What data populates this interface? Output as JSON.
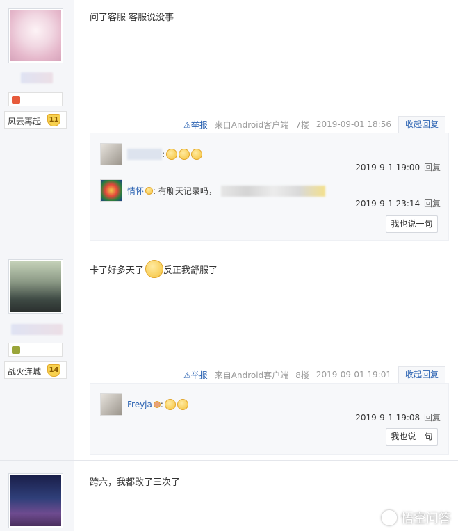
{
  "watermark": "悟空问答",
  "posts": [
    {
      "user": {
        "level_title": "风云再起",
        "level": "11"
      },
      "content": "问了客服 客服说没事",
      "meta": {
        "report": "举报",
        "source": "来自Android客户端",
        "floor": "7楼",
        "time": "2019-09-01 18:56",
        "toggle": "收起回复"
      },
      "replies": [
        {
          "name": "",
          "text": ":",
          "time": "2019-9-1 19:00",
          "reply": "回复"
        },
        {
          "name": "情怀",
          "text": ": 有聊天记录吗，",
          "time": "2019-9-1 23:14",
          "reply": "回复"
        }
      ],
      "say_button": "我也说一句"
    },
    {
      "user": {
        "level_title": "战火连城",
        "level": "14"
      },
      "content_before": "卡了好多天了",
      "content_after": "反正我舒服了",
      "meta": {
        "report": "举报",
        "source": "来自Android客户端",
        "floor": "8楼",
        "time": "2019-09-01 19:01",
        "toggle": "收起回复"
      },
      "replies": [
        {
          "name": "Freyja",
          "text": ":",
          "time": "2019-9-1 19:08",
          "reply": "回复"
        }
      ],
      "say_button": "我也说一句"
    },
    {
      "content": "跨六，我都改了三次了"
    }
  ],
  "colors": {
    "link": "#2d64b3",
    "sidebar": "#f5f6f9",
    "lzl_bg": "#f7f8fa"
  },
  "icons": [
    "warning-icon",
    "smiley-icon",
    "level-badge-icon",
    "watermark-logo-icon"
  ]
}
